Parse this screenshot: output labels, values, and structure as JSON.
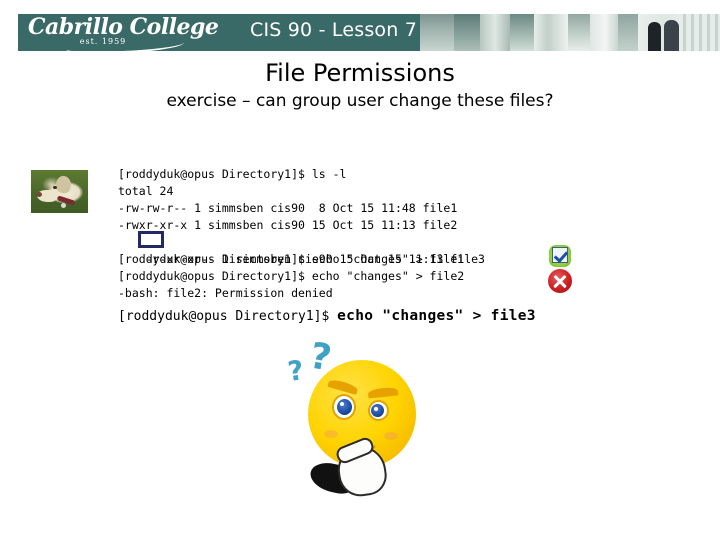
{
  "banner": {
    "logo_word": "Cabrillo College",
    "logo_est": "est. 1959",
    "title": "CIS 90 - Lesson 7",
    "teal": "#3a6a68"
  },
  "slide": {
    "title": "File Permissions",
    "subtitle": "exercise – can group user change these files?"
  },
  "terminal": {
    "lines": [
      "[roddyduk@opus Directory1]$ ls -l",
      "total 24",
      "-rw-rw-r-- 1 simmsben cis90  8 Oct 15 11:48 file1",
      "-rwxr-xr-x 1 simmsben cis90 15 Oct 15 11:13 file2",
      "-r-xr-xr-- 1 simmsben cis90 15 Oct 15 11:13 file3",
      "[roddyduk@opus Directory1]$ echo \"changes\" > file1",
      "[roddyduk@opus Directory1]$ echo \"changes\" > file2",
      "-bash: file2: Permission denied"
    ],
    "last_prompt": "[roddyduk@opus Directory1]$ ",
    "last_command": "echo \"changes\" > file3",
    "highlight_color": "#232a63",
    "highlighted_text": "r-x"
  },
  "icons": {
    "allowed": "green-check-icon",
    "denied": "red-x-icon",
    "thinking_face": "thinking-smiley-icon",
    "dog_photo": "dog-photo",
    "question_big": "?",
    "question_small": "?"
  },
  "colors": {
    "allowed_green": "#8fcf3a",
    "denied_red": "#cc1f22",
    "question_blue": "#3fa2c4",
    "face_yellow": "#ffd400"
  }
}
